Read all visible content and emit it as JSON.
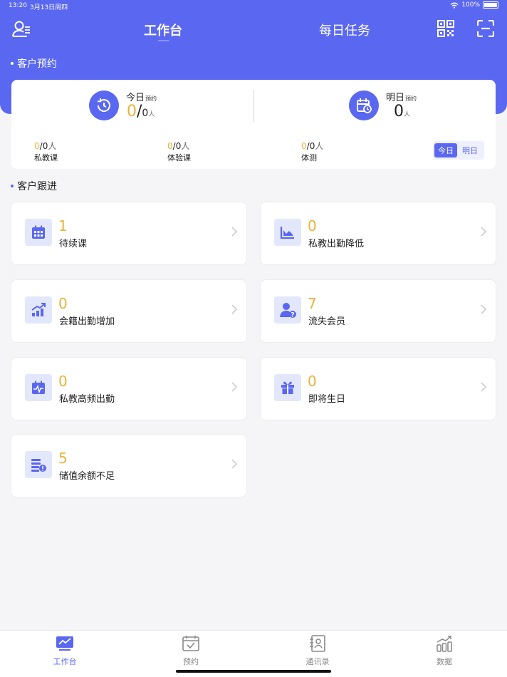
{
  "status": {
    "time": "13:20",
    "date": "3月13日周四",
    "battery": "100%"
  },
  "nav": {
    "tabs": [
      "工作台",
      "每日任务"
    ]
  },
  "appointments": {
    "section_title": "客户预约",
    "today": {
      "label": "今日",
      "sub": "预约",
      "done": "0",
      "slash": "/",
      "total": "0",
      "unit": "人"
    },
    "tomorrow": {
      "label": "明日",
      "sub": "预约",
      "count": "0",
      "unit": "人"
    },
    "stats": [
      {
        "done": "0",
        "total": "0",
        "unit": "人",
        "name": "私教课"
      },
      {
        "done": "0",
        "total": "0",
        "unit": "人",
        "name": "体验课"
      },
      {
        "done": "0",
        "total": "0",
        "unit": "人",
        "name": "体测"
      }
    ],
    "toggle": [
      "今日",
      "明日"
    ]
  },
  "follow": {
    "section_title": "客户跟进",
    "cards": [
      {
        "count": "1",
        "label": "待续课",
        "icon": "calendar-grid-icon"
      },
      {
        "count": "0",
        "label": "私教出勤降低",
        "icon": "chart-down-icon"
      },
      {
        "count": "0",
        "label": "会籍出勤增加",
        "icon": "chart-up-icon"
      },
      {
        "count": "7",
        "label": "流失会员",
        "icon": "user-question-icon"
      },
      {
        "count": "0",
        "label": "私教高频出勤",
        "icon": "calendar-pulse-icon"
      },
      {
        "count": "0",
        "label": "即将生日",
        "icon": "gift-icon"
      },
      {
        "count": "5",
        "label": "储值余额不足",
        "icon": "coins-alert-icon"
      }
    ]
  },
  "tabbar": {
    "items": [
      {
        "label": "工作台",
        "active": true
      },
      {
        "label": "预约",
        "active": false
      },
      {
        "label": "通讯录",
        "active": false
      },
      {
        "label": "数据",
        "active": false
      }
    ]
  },
  "colors": {
    "primary": "#5a67f0",
    "accent_number": "#e8b23a",
    "icon_bg": "#e3e7fc"
  }
}
